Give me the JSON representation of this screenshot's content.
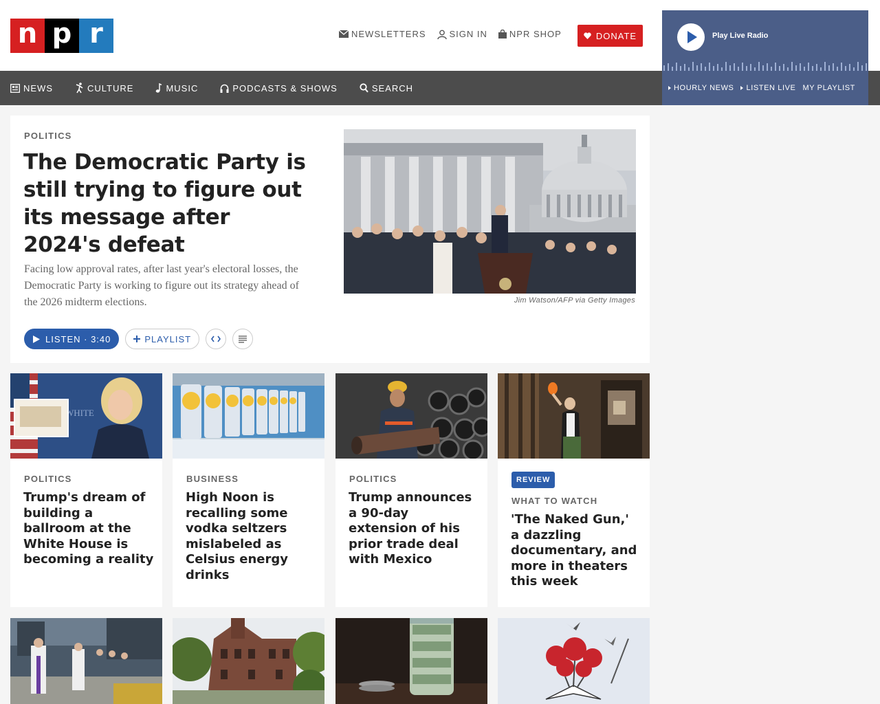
{
  "header": {
    "logo_letters": [
      "n",
      "p",
      "r"
    ],
    "util": {
      "newsletters": "NEWSLETTERS",
      "sign_in": "SIGN IN",
      "shop": "NPR SHOP"
    },
    "donate": "DONATE"
  },
  "nav": {
    "news": "NEWS",
    "culture": "CULTURE",
    "music": "MUSIC",
    "podcasts": "PODCASTS & SHOWS",
    "search": "SEARCH"
  },
  "player": {
    "label": "Play Live Radio",
    "hourly": "HOURLY NEWS",
    "listen_live": "LISTEN LIVE",
    "my_playlist": "MY PLAYLIST"
  },
  "hero": {
    "slug": "POLITICS",
    "headline": "The Democratic Party is still trying to figure out its message after 2024's defeat",
    "teaser": "Facing low approval rates, after last year's electoral losses, the Democratic Party is working to figure out its strategy ahead of the 2026 midterm elections.",
    "credit": "Jim Watson/AFP via Getty Images",
    "listen": "LISTEN · 3:40",
    "playlist": "PLAYLIST"
  },
  "cards": [
    {
      "slug": "POLITICS",
      "headline": "Trump's dream of building a ballroom at the White House is becoming a reality"
    },
    {
      "slug": "BUSINESS",
      "headline": "High Noon is recalling some vodka seltzers mislabeled as Celsius energy drinks"
    },
    {
      "slug": "POLITICS",
      "headline": "Trump announces a 90-day extension of his prior trade deal with Mexico"
    },
    {
      "badge": "REVIEW",
      "slug": "WHAT TO WATCH",
      "headline": "'The Naked Gun,' a dazzling documentary, and more in theaters this week"
    }
  ],
  "colors": {
    "npr_red": "#d62021",
    "npr_blue": "#237bbd",
    "link_blue": "#2c5dab",
    "player_bg": "#4b5e88",
    "nav_bg": "#4c4c4c"
  }
}
